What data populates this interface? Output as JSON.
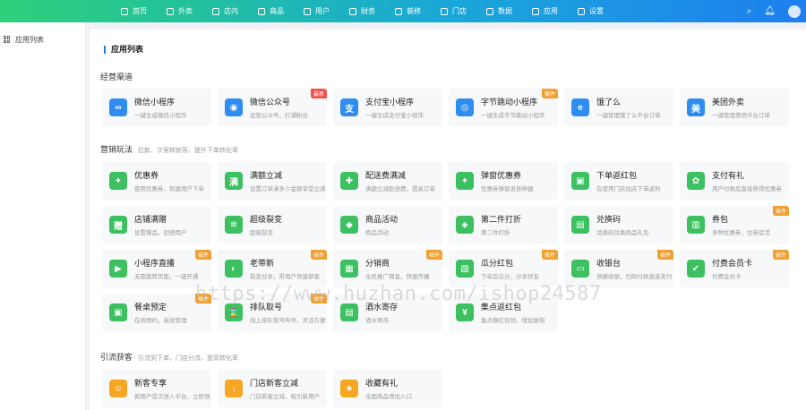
{
  "topbar": {
    "nav": [
      {
        "label": "首页",
        "icon": "home-icon"
      },
      {
        "label": "外卖",
        "icon": "takeout-icon"
      },
      {
        "label": "店内",
        "icon": "store-icon"
      },
      {
        "label": "商品",
        "icon": "goods-icon"
      },
      {
        "label": "用户",
        "icon": "user-icon"
      },
      {
        "label": "财务",
        "icon": "finance-icon"
      },
      {
        "label": "装修",
        "icon": "decorate-icon"
      },
      {
        "label": "门店",
        "icon": "shop-icon"
      },
      {
        "label": "数据",
        "icon": "data-icon"
      },
      {
        "label": "应用",
        "icon": "apps-icon"
      },
      {
        "label": "设置",
        "icon": "settings-icon"
      }
    ]
  },
  "sidebar": {
    "item": "应用列表"
  },
  "main": {
    "title": "应用列表"
  },
  "sections": [
    {
      "title": "经营渠道",
      "desc": ""
    },
    {
      "title": "营销玩法",
      "desc": "拉新、次客转新客、提升下单转化率"
    },
    {
      "title": "引流获客",
      "desc": "引流到下单，门店分流，提高转化率"
    }
  ],
  "channels": [
    {
      "name": "微信小程序",
      "desc": "一键生成微信小程序",
      "color": "#2f8cf0",
      "glyph": "∞",
      "badge": ""
    },
    {
      "name": "微信公众号",
      "desc": "运营公众号，打通粉丝",
      "color": "#2f8cf0",
      "glyph": "◉",
      "badge": "最新"
    },
    {
      "name": "支付宝小程序",
      "desc": "一键生成支付宝小程序",
      "color": "#2f8cf0",
      "glyph": "支",
      "badge": ""
    },
    {
      "name": "字节跳动小程序",
      "desc": "一键生成字节跳动小程序",
      "color": "#2f8cf0",
      "glyph": "◎",
      "badge": "插件"
    },
    {
      "name": "饿了么",
      "desc": "一键管理饿了么平台订单",
      "color": "#2f8cf0",
      "glyph": "e",
      "badge": ""
    },
    {
      "name": "美团外卖",
      "desc": "一键管理美团平台订单",
      "color": "#2f8cf0",
      "glyph": "美",
      "badge": ""
    }
  ],
  "marketing": [
    {
      "name": "优惠券",
      "desc": "使用优惠券，刺激用户下单",
      "color": "#3cc060",
      "glyph": "✦",
      "badge": ""
    },
    {
      "name": "满额立减",
      "desc": "设置订单满多少金额享受立减",
      "color": "#3cc060",
      "glyph": "满",
      "badge": ""
    },
    {
      "name": "配送费满减",
      "desc": "满额立减配送费，提高订单",
      "color": "#3cc060",
      "glyph": "✚",
      "badge": ""
    },
    {
      "name": "弹窗优惠券",
      "desc": "优惠券弹窗发放神器",
      "color": "#3cc060",
      "glyph": "✦",
      "badge": ""
    },
    {
      "name": "下单返红包",
      "desc": "在使用门店加店下单返利",
      "color": "#3cc060",
      "glyph": "▣",
      "badge": ""
    },
    {
      "name": "支付有礼",
      "desc": "用户付款后直接获得优惠券",
      "color": "#3cc060",
      "glyph": "✿",
      "badge": ""
    },
    {
      "name": "店铺满赠",
      "desc": "设置赠品，回馈用户",
      "color": "#3cc060",
      "glyph": "赠",
      "badge": ""
    },
    {
      "name": "超级裂变",
      "desc": "超级裂变",
      "color": "#3cc060",
      "glyph": "✲",
      "badge": ""
    },
    {
      "name": "商品活动",
      "desc": "商品活动",
      "color": "#3cc060",
      "glyph": "◆",
      "badge": ""
    },
    {
      "name": "第二件打折",
      "desc": "第二件打折",
      "color": "#3cc060",
      "glyph": "◈",
      "badge": ""
    },
    {
      "name": "兑换码",
      "desc": "兑换码兑换商品礼包",
      "color": "#3cc060",
      "glyph": "▤",
      "badge": ""
    },
    {
      "name": "券包",
      "desc": "多种优惠券，拉新促活",
      "color": "#3cc060",
      "glyph": "▥",
      "badge": "插件"
    },
    {
      "name": "小程序直播",
      "desc": "无需跳转页面，一键开通",
      "color": "#3cc060",
      "glyph": "▶",
      "badge": "插件"
    },
    {
      "name": "老带新",
      "desc": "裂变分享，带用户快速获客",
      "color": "#3cc060",
      "glyph": "◐",
      "badge": "插件"
    },
    {
      "name": "分销商",
      "desc": "全民推广佣金，快速传播",
      "color": "#3cc060",
      "glyph": "▦",
      "badge": "插件"
    },
    {
      "name": "瓜分红包",
      "desc": "下单后瓜分，分享好友",
      "color": "#3cc060",
      "glyph": "▧",
      "badge": "插件"
    },
    {
      "name": "收银台",
      "desc": "快捷收银，扫码付款直接支付",
      "color": "#3cc060",
      "glyph": "▭",
      "badge": "插件"
    },
    {
      "name": "付费会员卡",
      "desc": "付费会员卡",
      "color": "#3cc060",
      "glyph": "✔",
      "badge": "插件"
    },
    {
      "name": "餐桌预定",
      "desc": "在线预约，高效管理",
      "color": "#3cc060",
      "glyph": "▣",
      "badge": "插件"
    },
    {
      "name": "排队取号",
      "desc": "线上排队取号叫号，灵活方便",
      "color": "#3cc060",
      "glyph": "⌛",
      "badge": "插件"
    },
    {
      "name": "酒水寄存",
      "desc": "酒水寄存",
      "color": "#3cc060",
      "glyph": "▤",
      "badge": ""
    },
    {
      "name": "集点返红包",
      "desc": "集点换红包领，增加复购",
      "color": "#3cc060",
      "glyph": "¥",
      "badge": ""
    }
  ],
  "traffic": [
    {
      "name": "新客专享",
      "desc": "新用户首次进入平台，立即领取",
      "color": "#f5a623",
      "glyph": "☺",
      "badge": ""
    },
    {
      "name": "门店新客立减",
      "desc": "门店新客立减，吸引新用户",
      "color": "#f5a623",
      "glyph": "↓",
      "badge": ""
    },
    {
      "name": "收藏有礼",
      "desc": "全国商品增加入口",
      "color": "#f5a623",
      "glyph": "★",
      "badge": ""
    }
  ],
  "watermark": "https://www.huzhan.com/ishop24587"
}
